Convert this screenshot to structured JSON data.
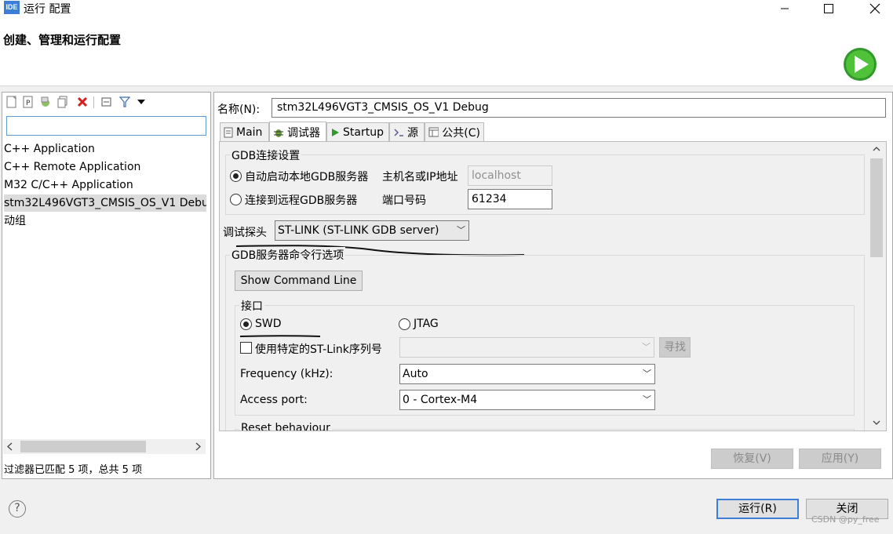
{
  "window": {
    "app_icon_text": "IDE",
    "title": "运行 配置",
    "minimize_glyph": "—",
    "maximize_glyph": "☐",
    "close_glyph": "✕"
  },
  "header": {
    "title": "创建、管理和运行配置"
  },
  "left": {
    "filter_value": "",
    "tree": [
      "C++ Application",
      "C++ Remote Application",
      "M32 C/C++ Application",
      "stm32L496VGT3_CMSIS_OS_V1 Debug",
      "动组"
    ],
    "selected_index": 3,
    "status": "过滤器已匹配 5 项，总共 5 项"
  },
  "config": {
    "name_label": "名称(N):",
    "name_value": "stm32L496VGT3_CMSIS_OS_V1 Debug",
    "tabs": [
      "Main",
      "调试器",
      "Startup",
      "源",
      "公共(C)"
    ],
    "gdb_group_title": "GDB连接设置",
    "auto_start_label": "自动启动本地GDB服务器",
    "host_label": "主机名或IP地址",
    "host_value": "localhost",
    "remote_label": "连接到远程GDB服务器",
    "port_label": "端口号码",
    "port_value": "61234",
    "probe_label": "调试探头",
    "probe_value": "ST-LINK (ST-LINK GDB server)",
    "server_group_title": "GDB服务器命令行选项",
    "show_cmd_label": "Show Command Line",
    "interface_title": "接口",
    "swd_label": "SWD",
    "jtag_label": "JTAG",
    "serial_label": "使用特定的ST-Link序列号",
    "serial_value": "",
    "scan_label": "寻找",
    "freq_label": "Frequency (kHz):",
    "freq_value": "Auto",
    "port_access_label": "Access port:",
    "port_access_value": "0 - Cortex-M4",
    "reset_label": "Reset behaviour"
  },
  "buttons": {
    "revert": "恢复(V)",
    "apply": "应用(Y)",
    "run": "运行(R)",
    "close": "关闭",
    "help": "?"
  },
  "watermark": "CSDN @py_free",
  "colors": {
    "accent": "#3d7fd6",
    "run_green": "#3cb52a"
  }
}
